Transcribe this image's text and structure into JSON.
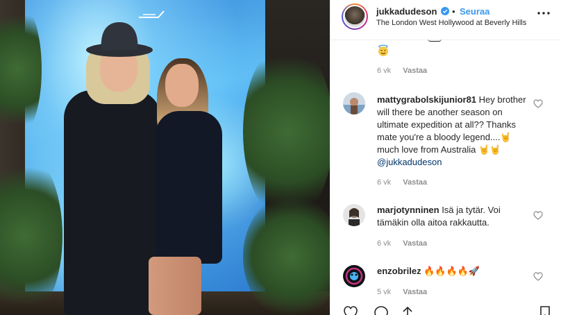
{
  "post": {
    "username": "jukkadudeson",
    "separator": "•",
    "follow_label": "Seuraa",
    "location": "The London West Hollywood at Beverly Hills"
  },
  "comments": [
    {
      "username": "",
      "text": "",
      "emoji": "smiling-face-with-halo",
      "time": "6 vk",
      "reply_label": "Vastaa"
    },
    {
      "username": "mattygrabolskijunior81",
      "text": " Hey brother will there be another season on ultimate expedition at all?? Thanks mate you're a bloody legend....🤘 much love from Australia 🤘🤘 ",
      "mention": "@jukkadudeson",
      "time": "6 vk",
      "reply_label": "Vastaa"
    },
    {
      "username": "marjotynninen",
      "text": " Isä ja tytär. Voi tämäkin olla aitoa rakkautta.",
      "time": "6 vk",
      "reply_label": "Vastaa"
    },
    {
      "username": "enzobrilez",
      "text": " 🔥🔥🔥🔥🚀",
      "time": "5 vk",
      "reply_label": "Vastaa"
    }
  ],
  "colors": {
    "link_blue": "#3897f0",
    "mention_blue": "#003569",
    "meta_gray": "#8e8e8e",
    "text": "#262626"
  },
  "icons": {
    "header_more": "more-horizontal-icon",
    "verified": "verified-badge-icon",
    "comment_like": "heart-outline-icon",
    "actions": [
      "heart-outline-icon",
      "comment-icon",
      "share-icon",
      "bookmark-icon"
    ]
  }
}
